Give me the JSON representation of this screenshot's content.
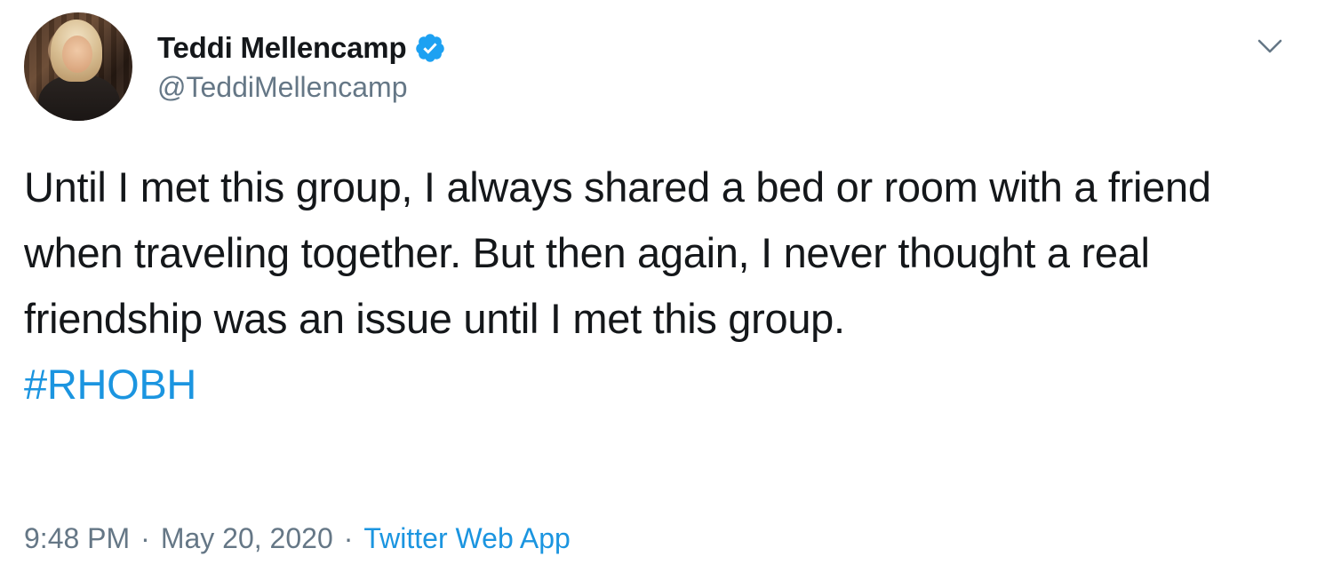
{
  "author": {
    "display_name": "Teddi Mellencamp",
    "handle": "@TeddiMellencamp",
    "verified": true
  },
  "tweet": {
    "text": "Until I met this group, I always shared a bed or room with a friend when traveling together. But then again, I never thought a real friendship was an issue until I met this group.",
    "hashtag": "#RHOBH"
  },
  "meta": {
    "time": "9:48 PM",
    "separator": "·",
    "date": "May 20, 2020",
    "source": "Twitter Web App"
  },
  "colors": {
    "text": "#14171a",
    "secondary": "#657786",
    "link": "#1b95e0",
    "verified_badge": "#1da1f2"
  },
  "icons": {
    "verified": "verified-badge-icon",
    "menu": "chevron-down-icon"
  }
}
